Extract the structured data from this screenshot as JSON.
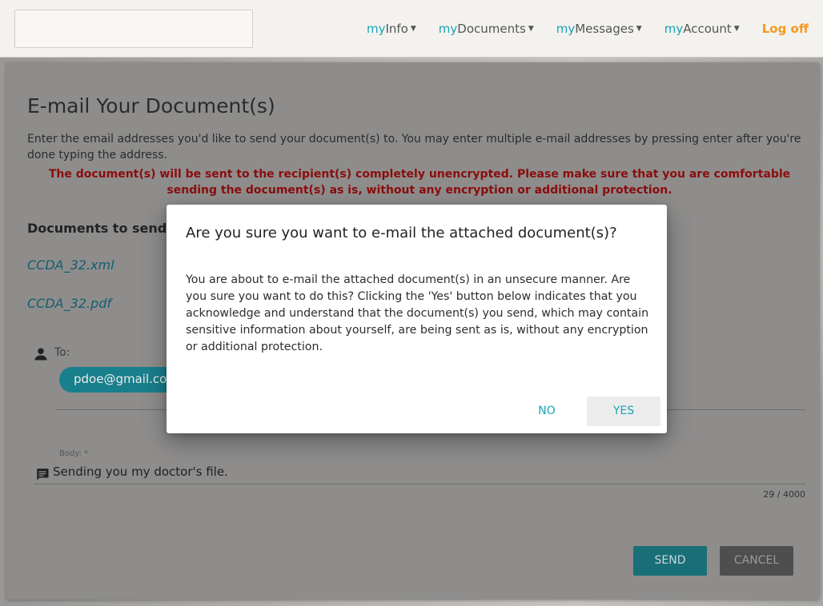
{
  "nav": {
    "items": [
      {
        "prefix": "my",
        "label": "Info"
      },
      {
        "prefix": "my",
        "label": "Documents"
      },
      {
        "prefix": "my",
        "label": "Messages"
      },
      {
        "prefix": "my",
        "label": "Account"
      }
    ],
    "logoff": "Log off"
  },
  "page": {
    "title": "E-mail Your Document(s)",
    "intro": "Enter the email addresses you'd like to send your document(s) to. You may enter multiple e-mail addresses by pressing enter after you're done typing the address.",
    "warning": "The document(s) will be sent to the recipient(s) completely unencrypted. Please make sure that you are comfortable sending the document(s) as is, without any encryption or additional protection.",
    "docs_label": "Documents to send:",
    "documents": [
      "CCDA_32.xml",
      "CCDA_32.pdf"
    ]
  },
  "form": {
    "to_label": "To:",
    "recipient_chip": "pdoe@gmail.co",
    "body_label": "Body: *",
    "body_value": "Sending you my doctor's file.",
    "counter": "29 / 4000",
    "send": "SEND",
    "cancel": "CANCEL"
  },
  "modal": {
    "title": "Are you sure you want to e-mail the attached document(s)?",
    "body": "You are about to e-mail the attached document(s) in an unsecure manner. Are you sure you want to do this? Clicking the 'Yes' button below indicates that you acknowledge and understand that the document(s) you send, which may contain sensitive information about yourself, are being sent as is, without any encryption or additional protection.",
    "no": "NO",
    "yes": "YES"
  },
  "icons": {
    "person": "person-icon",
    "message": "message-icon",
    "caret": "caret-down-icon"
  },
  "colors": {
    "accent": "#1aa3b3",
    "logoff": "#f59a1b",
    "warning": "#8b0d0d"
  }
}
